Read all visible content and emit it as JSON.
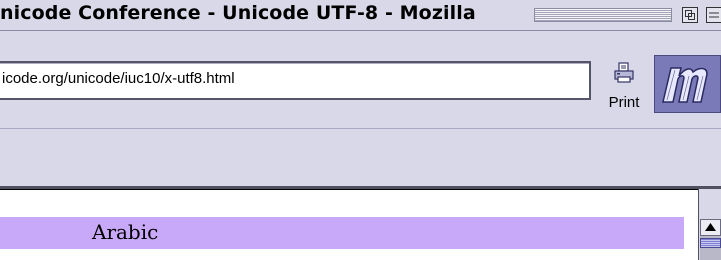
{
  "window": {
    "title": "nicode Conference - Unicode UTF-8 - Mozilla"
  },
  "toolbar": {
    "url": "icode.org/unicode/iuc10/x-utf8.html",
    "print_label": "Print",
    "print_icon": "printer-icon",
    "throbber_icon": "mozilla-m-logo"
  },
  "content": {
    "section_title": "Arabic",
    "section_color": "#c8a8f8"
  },
  "colors": {
    "chrome": "#d8d8e8",
    "throbber": "#7a7ab8"
  }
}
